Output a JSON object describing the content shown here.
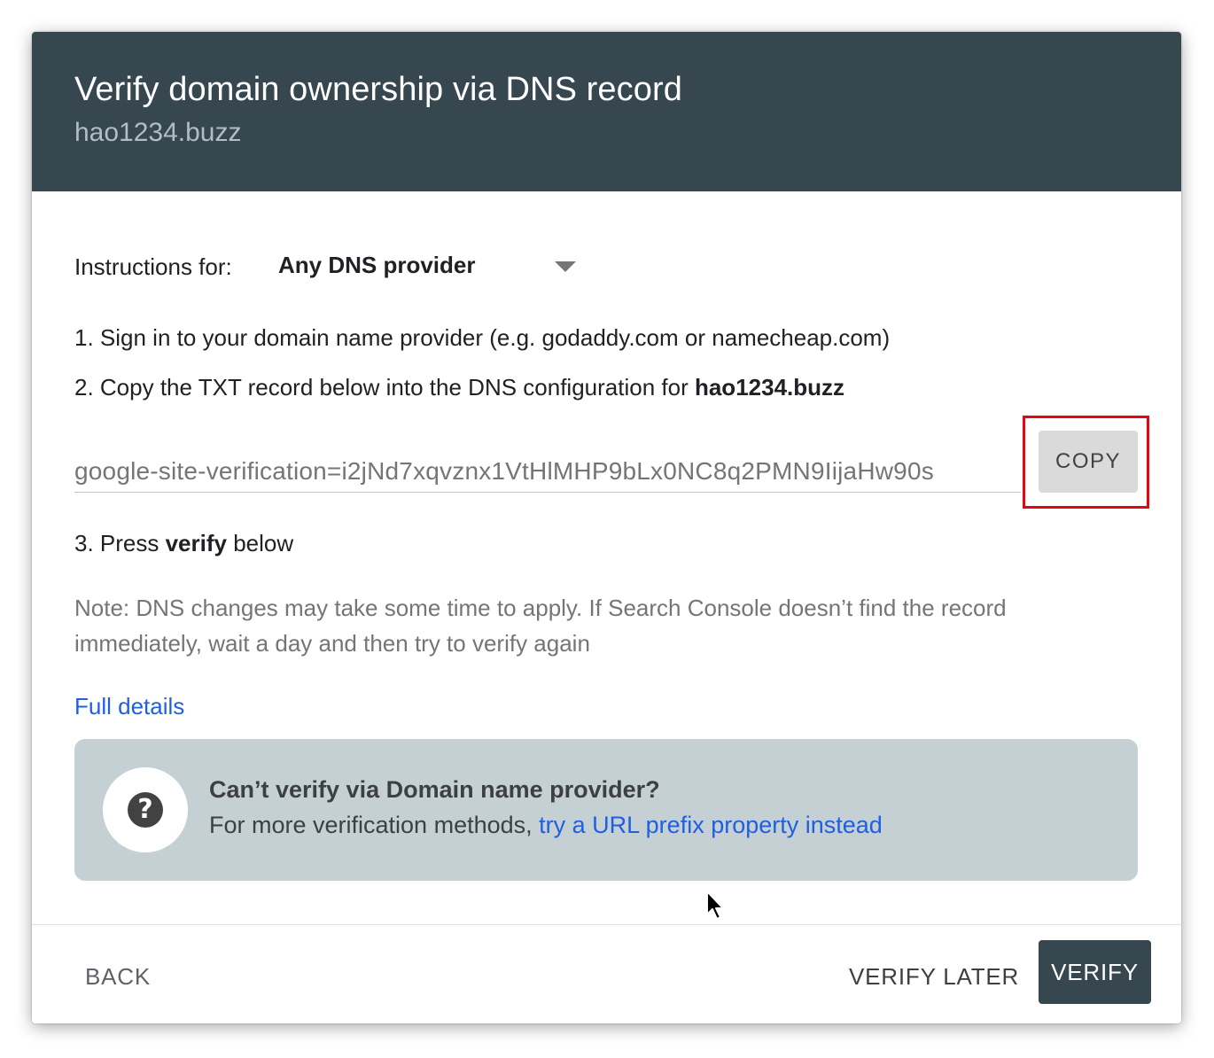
{
  "dialog": {
    "title": "Verify domain ownership via DNS record",
    "subtitle": "hao1234.buzz"
  },
  "instructions": {
    "label": "Instructions for:",
    "provider_selected": "Any DNS provider"
  },
  "steps": {
    "step1": "1. Sign in to your domain name provider (e.g. godaddy.com or namecheap.com)",
    "step2_prefix": "2. Copy the TXT record below into the DNS configuration for ",
    "step2_domain": "hao1234.buzz",
    "step3_prefix": "3. Press ",
    "step3_bold": "verify",
    "step3_suffix": " below"
  },
  "txt_record": {
    "value": "google-site-verification=i2jNd7xqvznx1VtHlMHP9bLx0NC8q2PMN9IijaHw90s",
    "copy_label": "COPY"
  },
  "note": "Note: DNS changes may take some time to apply. If Search Console doesn’t find the record immediately, wait a day and then try to verify again",
  "full_details_link": "Full details",
  "help": {
    "title": "Can’t verify via Domain name provider?",
    "text": "For more verification methods, ",
    "link": "try a URL prefix property instead"
  },
  "footer": {
    "back_label": "BACK",
    "verify_later_label": "VERIFY LATER",
    "verify_label": "VERIFY"
  },
  "colors": {
    "header_bg": "#37474f",
    "link": "#1f5fe0",
    "highlight": "#e30613",
    "help_bg": "#c5d0d5"
  },
  "icons": {
    "dropdown": "caret-down-icon",
    "help": "question-circle-icon",
    "pointer": "mouse-cursor-icon"
  }
}
